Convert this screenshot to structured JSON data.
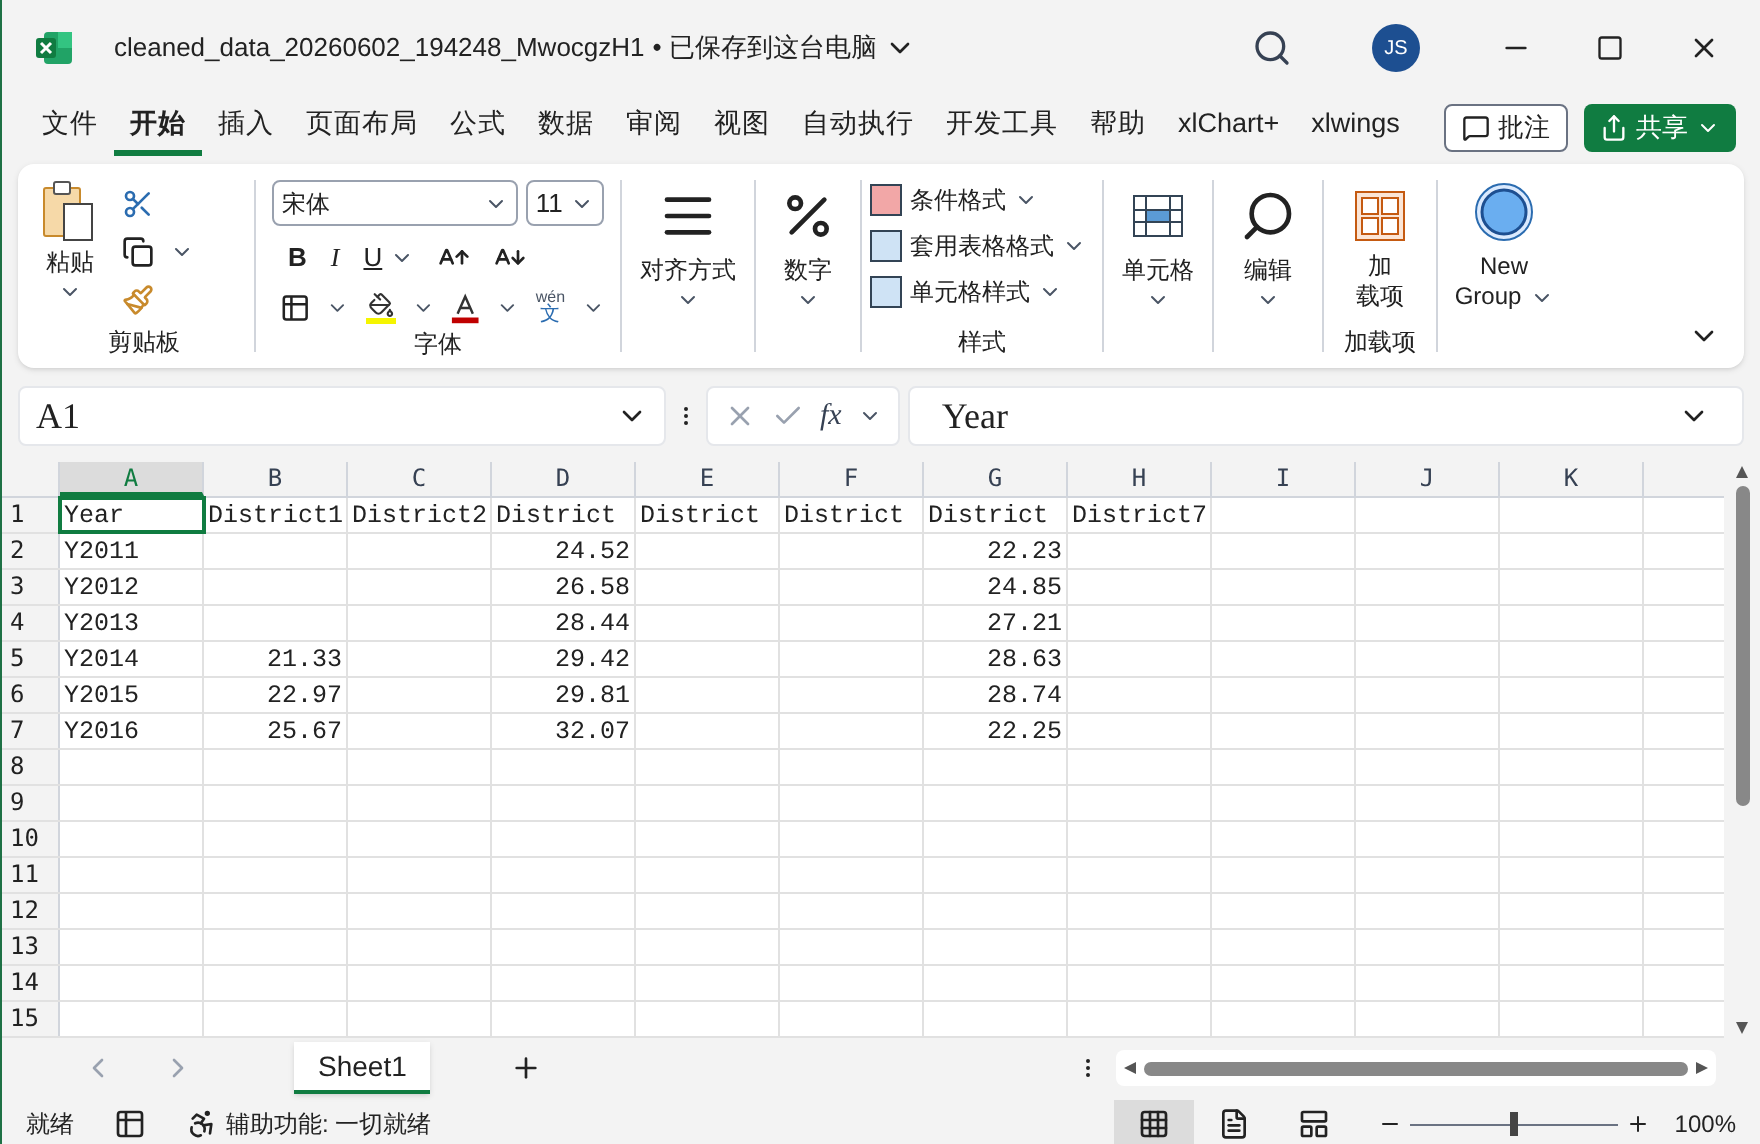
{
  "window": {
    "title": "cleaned_data_20260602_194248_MwocgzH1",
    "save_status": "• 已保存到这台电脑",
    "avatar": "JS"
  },
  "ribbon_tabs": [
    {
      "label": "文件",
      "selected": false
    },
    {
      "label": "开始",
      "selected": true
    },
    {
      "label": "插入",
      "selected": false
    },
    {
      "label": "页面布局",
      "selected": false
    },
    {
      "label": "公式",
      "selected": false
    },
    {
      "label": "数据",
      "selected": false
    },
    {
      "label": "审阅",
      "selected": false
    },
    {
      "label": "视图",
      "selected": false
    },
    {
      "label": "自动执行",
      "selected": false
    },
    {
      "label": "开发工具",
      "selected": false
    },
    {
      "label": "帮助",
      "selected": false
    },
    {
      "label": "xlChart+",
      "selected": false
    },
    {
      "label": "xlwings",
      "selected": false
    }
  ],
  "comments_button": "批注",
  "share_button": "共享",
  "ribbon": {
    "clipboard": {
      "paste": "粘贴",
      "group": "剪贴板"
    },
    "font": {
      "font_name": "宋体",
      "font_size": "11",
      "bold": "B",
      "italic": "I",
      "underline": "U",
      "phonetic_top": "wén",
      "phonetic_bottom": "文",
      "group": "字体"
    },
    "alignment": "对齐方式",
    "number": "数字",
    "styles": {
      "items": [
        "条件格式",
        "套用表格格式",
        "单元格样式"
      ],
      "group": "样式"
    },
    "cells": "单元格",
    "editing": "编辑",
    "addins": {
      "button_top": "加",
      "button_bottom": "载项",
      "group": "加载项"
    },
    "new_group": {
      "top": "New",
      "bottom": "Group"
    }
  },
  "formula_bar": {
    "name_box": "A1",
    "function_button": "fx",
    "formula": "Year"
  },
  "grid": {
    "columns": [
      {
        "label": "A",
        "selected": true
      },
      {
        "label": "B",
        "selected": false
      },
      {
        "label": "C",
        "selected": false
      },
      {
        "label": "D",
        "selected": false
      },
      {
        "label": "E",
        "selected": false
      },
      {
        "label": "F",
        "selected": false
      },
      {
        "label": "G",
        "selected": false
      },
      {
        "label": "H",
        "selected": false
      },
      {
        "label": "I",
        "selected": false
      },
      {
        "label": "J",
        "selected": false
      },
      {
        "label": "K",
        "selected": false
      }
    ],
    "rows": [
      {
        "label": "1",
        "cells": [
          {
            "text": "Year",
            "kind": "text"
          },
          {
            "text": "District1",
            "kind": "text"
          },
          {
            "text": "District2",
            "kind": "text"
          },
          {
            "text": "District",
            "kind": "text"
          },
          {
            "text": "District",
            "kind": "text"
          },
          {
            "text": "District",
            "kind": "text"
          },
          {
            "text": "District",
            "kind": "text"
          },
          {
            "text": "District7",
            "kind": "text"
          }
        ]
      },
      {
        "label": "2",
        "cells": [
          {
            "text": "Y2011",
            "kind": "text"
          },
          null,
          null,
          {
            "text": "24.52",
            "kind": "number"
          },
          null,
          null,
          {
            "text": "22.23",
            "kind": "number"
          },
          null
        ]
      },
      {
        "label": "3",
        "cells": [
          {
            "text": "Y2012",
            "kind": "text"
          },
          null,
          null,
          {
            "text": "26.58",
            "kind": "number"
          },
          null,
          null,
          {
            "text": "24.85",
            "kind": "number"
          },
          null
        ]
      },
      {
        "label": "4",
        "cells": [
          {
            "text": "Y2013",
            "kind": "text"
          },
          null,
          null,
          {
            "text": "28.44",
            "kind": "number"
          },
          null,
          null,
          {
            "text": "27.21",
            "kind": "number"
          },
          null
        ]
      },
      {
        "label": "5",
        "cells": [
          {
            "text": "Y2014",
            "kind": "text"
          },
          {
            "text": "21.33",
            "kind": "number"
          },
          null,
          {
            "text": "29.42",
            "kind": "number"
          },
          null,
          null,
          {
            "text": "28.63",
            "kind": "number"
          },
          null
        ]
      },
      {
        "label": "6",
        "cells": [
          {
            "text": "Y2015",
            "kind": "text"
          },
          {
            "text": "22.97",
            "kind": "number"
          },
          null,
          {
            "text": "29.81",
            "kind": "number"
          },
          null,
          null,
          {
            "text": "28.74",
            "kind": "number"
          },
          null
        ]
      },
      {
        "label": "7",
        "cells": [
          {
            "text": "Y2016",
            "kind": "text"
          },
          {
            "text": "25.67",
            "kind": "number"
          },
          null,
          {
            "text": "32.07",
            "kind": "number"
          },
          null,
          null,
          {
            "text": "22.25",
            "kind": "number"
          },
          null
        ]
      },
      {
        "label": "8",
        "cells": []
      },
      {
        "label": "9",
        "cells": []
      },
      {
        "label": "10",
        "cells": []
      },
      {
        "label": "11",
        "cells": []
      },
      {
        "label": "12",
        "cells": []
      },
      {
        "label": "13",
        "cells": []
      },
      {
        "label": "14",
        "cells": []
      },
      {
        "label": "15",
        "cells": []
      }
    ]
  },
  "sheet_tabs": [
    {
      "label": "Sheet1",
      "selected": true
    }
  ],
  "status_bar": {
    "ready": "就绪",
    "accessibility": "辅助功能: 一切就绪",
    "views": [
      {
        "kind": "normal",
        "selected": true
      },
      {
        "kind": "page_layout",
        "selected": false
      },
      {
        "kind": "page_break",
        "selected": false
      }
    ],
    "zoom": {
      "level": 0.5,
      "label": "100%"
    }
  }
}
